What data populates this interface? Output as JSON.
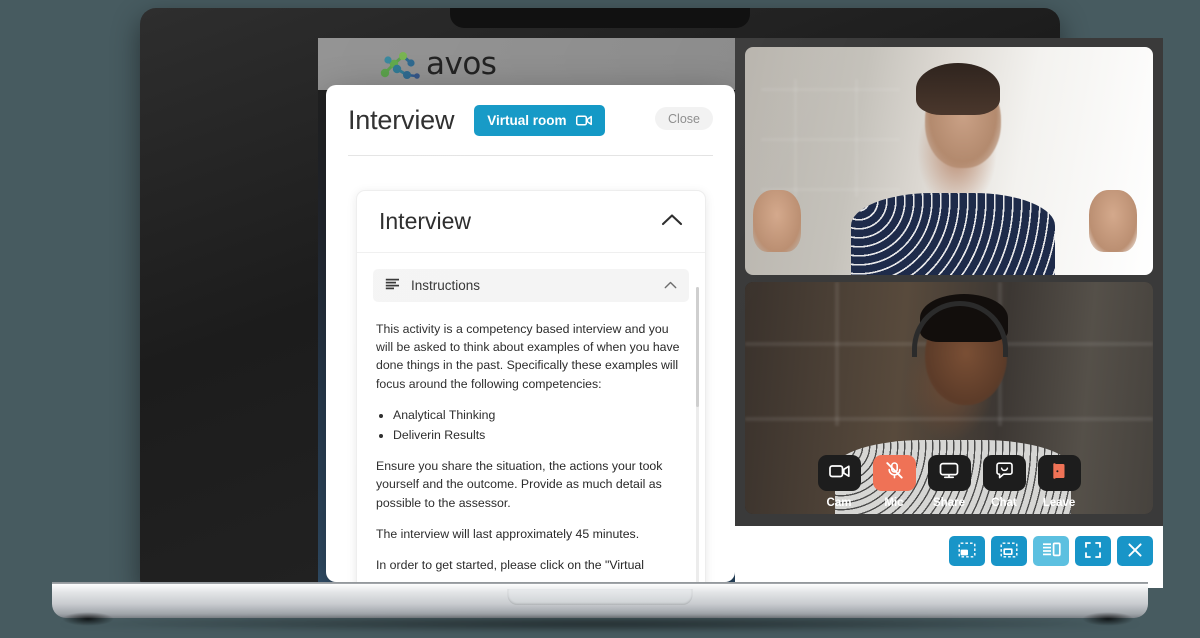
{
  "brand": {
    "name": "avos"
  },
  "background_page": {
    "partial_text": "s"
  },
  "modal": {
    "title": "Interview",
    "virtual_room_label": "Virtual room",
    "virtual_room_icon": "video-camera-icon",
    "close_label": "Close",
    "panel": {
      "title": "Interview",
      "collapse_icon": "chevron-up-icon",
      "accordion": {
        "label": "Instructions",
        "list_icon": "list-lines-icon",
        "chevron_icon": "chevron-up-icon",
        "paragraphs": [
          "This activity is a competency based interview and you will be asked to think about examples of when you have done things in the past. Specifically these examples will focus around the following competencies:"
        ],
        "competencies": [
          "Analytical Thinking",
          "Deliverin Results"
        ],
        "paragraphs_after": [
          "Ensure you share the situation, the actions your took yourself and the outcome. Provide as much detail as possible to the assessor.",
          "The interview will last approximately 45 minutes.",
          "In order to get started, please click on the \"Virtual"
        ]
      }
    }
  },
  "video": {
    "tiles": [
      {
        "name": "participant-1"
      },
      {
        "name": "participant-2"
      }
    ],
    "controls": [
      {
        "id": "cam",
        "label": "Cam",
        "icon": "video-camera-icon",
        "active": false
      },
      {
        "id": "mic",
        "label": "Mic",
        "icon": "microphone-muted-icon",
        "active": true
      },
      {
        "id": "share",
        "label": "Share",
        "icon": "screen-share-icon",
        "active": false
      },
      {
        "id": "chat",
        "label": "Chat",
        "icon": "chat-bubble-icon",
        "active": false
      },
      {
        "id": "leave",
        "label": "Leave",
        "icon": "exit-door-icon",
        "active": false
      }
    ]
  },
  "bottom_strip": {
    "buttons": [
      {
        "id": "pip-bottom-left",
        "icon": "picture-in-picture-bottom-left-icon",
        "state": "normal"
      },
      {
        "id": "pip-bottom-right",
        "icon": "picture-in-picture-bottom-right-icon",
        "state": "normal"
      },
      {
        "id": "sidebar-layout",
        "icon": "sidebar-layout-icon",
        "state": "selected"
      },
      {
        "id": "fullscreen",
        "icon": "fullscreen-icon",
        "state": "normal"
      },
      {
        "id": "close",
        "icon": "close-x-icon",
        "state": "normal"
      }
    ]
  },
  "colors": {
    "accent_blue": "#0b95c4",
    "strip_blue": "#1895c8",
    "strip_blue_selected": "#5cc0e0",
    "mic_active_coral": "#ef7256",
    "control_dark": "#1d1d1d",
    "topbar_gray": "#8a8a8a",
    "page_background": "#475b60"
  }
}
